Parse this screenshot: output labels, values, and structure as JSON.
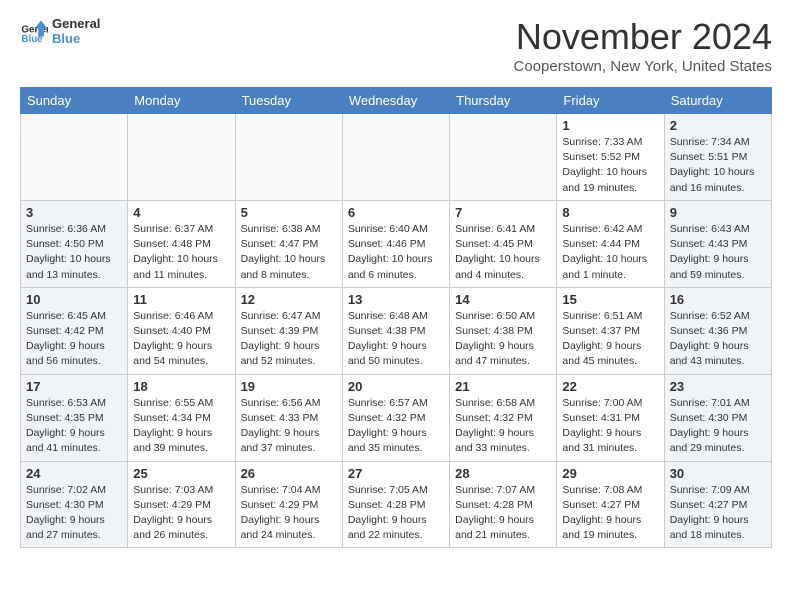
{
  "header": {
    "logo_line1": "General",
    "logo_line2": "Blue",
    "month_title": "November 2024",
    "location": "Cooperstown, New York, United States"
  },
  "days_of_week": [
    "Sunday",
    "Monday",
    "Tuesday",
    "Wednesday",
    "Thursday",
    "Friday",
    "Saturday"
  ],
  "weeks": [
    [
      {
        "day": "",
        "info": ""
      },
      {
        "day": "",
        "info": ""
      },
      {
        "day": "",
        "info": ""
      },
      {
        "day": "",
        "info": ""
      },
      {
        "day": "",
        "info": ""
      },
      {
        "day": "1",
        "info": "Sunrise: 7:33 AM\nSunset: 5:52 PM\nDaylight: 10 hours and 19 minutes."
      },
      {
        "day": "2",
        "info": "Sunrise: 7:34 AM\nSunset: 5:51 PM\nDaylight: 10 hours and 16 minutes."
      }
    ],
    [
      {
        "day": "3",
        "info": "Sunrise: 6:36 AM\nSunset: 4:50 PM\nDaylight: 10 hours and 13 minutes."
      },
      {
        "day": "4",
        "info": "Sunrise: 6:37 AM\nSunset: 4:48 PM\nDaylight: 10 hours and 11 minutes."
      },
      {
        "day": "5",
        "info": "Sunrise: 6:38 AM\nSunset: 4:47 PM\nDaylight: 10 hours and 8 minutes."
      },
      {
        "day": "6",
        "info": "Sunrise: 6:40 AM\nSunset: 4:46 PM\nDaylight: 10 hours and 6 minutes."
      },
      {
        "day": "7",
        "info": "Sunrise: 6:41 AM\nSunset: 4:45 PM\nDaylight: 10 hours and 4 minutes."
      },
      {
        "day": "8",
        "info": "Sunrise: 6:42 AM\nSunset: 4:44 PM\nDaylight: 10 hours and 1 minute."
      },
      {
        "day": "9",
        "info": "Sunrise: 6:43 AM\nSunset: 4:43 PM\nDaylight: 9 hours and 59 minutes."
      }
    ],
    [
      {
        "day": "10",
        "info": "Sunrise: 6:45 AM\nSunset: 4:42 PM\nDaylight: 9 hours and 56 minutes."
      },
      {
        "day": "11",
        "info": "Sunrise: 6:46 AM\nSunset: 4:40 PM\nDaylight: 9 hours and 54 minutes."
      },
      {
        "day": "12",
        "info": "Sunrise: 6:47 AM\nSunset: 4:39 PM\nDaylight: 9 hours and 52 minutes."
      },
      {
        "day": "13",
        "info": "Sunrise: 6:48 AM\nSunset: 4:38 PM\nDaylight: 9 hours and 50 minutes."
      },
      {
        "day": "14",
        "info": "Sunrise: 6:50 AM\nSunset: 4:38 PM\nDaylight: 9 hours and 47 minutes."
      },
      {
        "day": "15",
        "info": "Sunrise: 6:51 AM\nSunset: 4:37 PM\nDaylight: 9 hours and 45 minutes."
      },
      {
        "day": "16",
        "info": "Sunrise: 6:52 AM\nSunset: 4:36 PM\nDaylight: 9 hours and 43 minutes."
      }
    ],
    [
      {
        "day": "17",
        "info": "Sunrise: 6:53 AM\nSunset: 4:35 PM\nDaylight: 9 hours and 41 minutes."
      },
      {
        "day": "18",
        "info": "Sunrise: 6:55 AM\nSunset: 4:34 PM\nDaylight: 9 hours and 39 minutes."
      },
      {
        "day": "19",
        "info": "Sunrise: 6:56 AM\nSunset: 4:33 PM\nDaylight: 9 hours and 37 minutes."
      },
      {
        "day": "20",
        "info": "Sunrise: 6:57 AM\nSunset: 4:32 PM\nDaylight: 9 hours and 35 minutes."
      },
      {
        "day": "21",
        "info": "Sunrise: 6:58 AM\nSunset: 4:32 PM\nDaylight: 9 hours and 33 minutes."
      },
      {
        "day": "22",
        "info": "Sunrise: 7:00 AM\nSunset: 4:31 PM\nDaylight: 9 hours and 31 minutes."
      },
      {
        "day": "23",
        "info": "Sunrise: 7:01 AM\nSunset: 4:30 PM\nDaylight: 9 hours and 29 minutes."
      }
    ],
    [
      {
        "day": "24",
        "info": "Sunrise: 7:02 AM\nSunset: 4:30 PM\nDaylight: 9 hours and 27 minutes."
      },
      {
        "day": "25",
        "info": "Sunrise: 7:03 AM\nSunset: 4:29 PM\nDaylight: 9 hours and 26 minutes."
      },
      {
        "day": "26",
        "info": "Sunrise: 7:04 AM\nSunset: 4:29 PM\nDaylight: 9 hours and 24 minutes."
      },
      {
        "day": "27",
        "info": "Sunrise: 7:05 AM\nSunset: 4:28 PM\nDaylight: 9 hours and 22 minutes."
      },
      {
        "day": "28",
        "info": "Sunrise: 7:07 AM\nSunset: 4:28 PM\nDaylight: 9 hours and 21 minutes."
      },
      {
        "day": "29",
        "info": "Sunrise: 7:08 AM\nSunset: 4:27 PM\nDaylight: 9 hours and 19 minutes."
      },
      {
        "day": "30",
        "info": "Sunrise: 7:09 AM\nSunset: 4:27 PM\nDaylight: 9 hours and 18 minutes."
      }
    ]
  ]
}
